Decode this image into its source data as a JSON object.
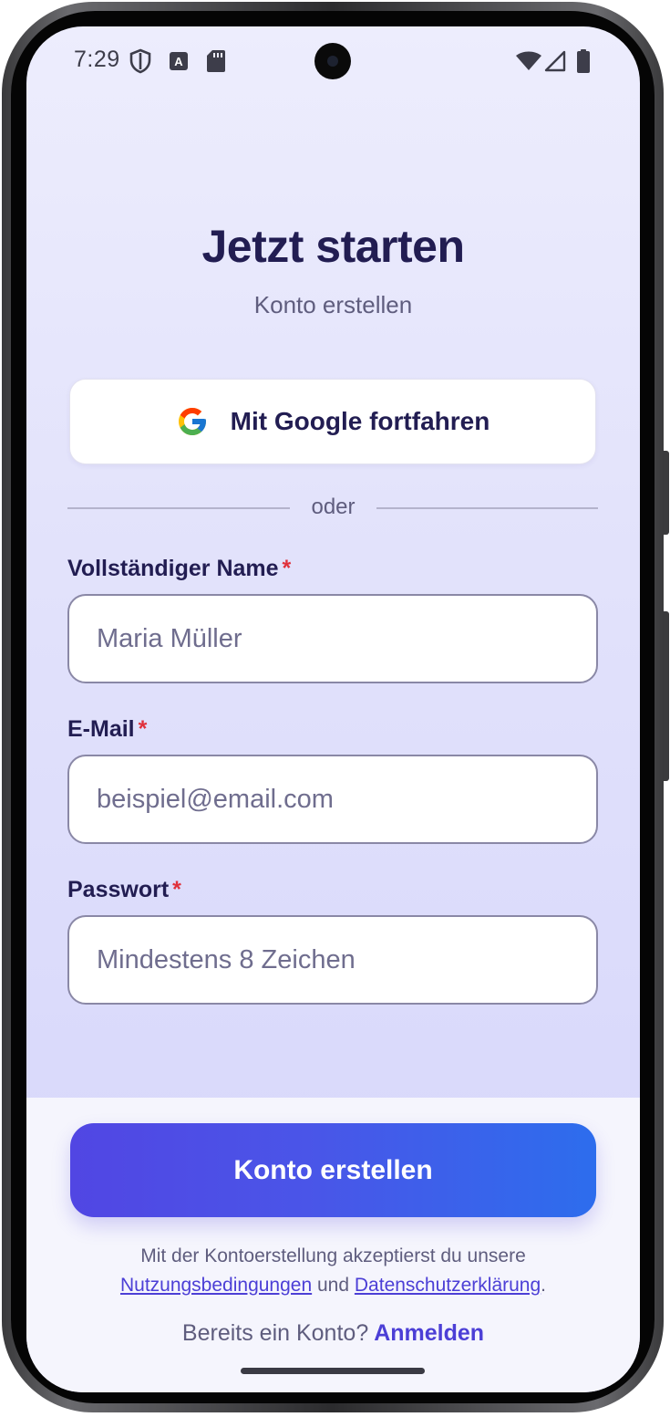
{
  "status_bar": {
    "time": "7:29",
    "left_icons": [
      "shield-icon",
      "font-a-icon",
      "sd-card-icon"
    ],
    "right_icons": [
      "wifi-icon",
      "cellular-signal-icon",
      "battery-icon"
    ]
  },
  "header": {
    "title": "Jetzt starten",
    "subtitle": "Konto erstellen"
  },
  "google_button": {
    "label": "Mit Google fortfahren",
    "icon": "google-logo-icon"
  },
  "divider": {
    "text": "oder"
  },
  "form": {
    "name": {
      "label": "Vollständiger Name",
      "required_mark": "*",
      "placeholder": "Maria Müller",
      "value": ""
    },
    "email": {
      "label": "E-Mail",
      "required_mark": "*",
      "placeholder": "beispiel@email.com",
      "value": ""
    },
    "password": {
      "label": "Passwort",
      "required_mark": "*",
      "placeholder": "Mindestens 8 Zeichen",
      "value": ""
    }
  },
  "submit_button": {
    "label": "Konto erstellen"
  },
  "legal": {
    "prefix": "Mit der Kontoerstellung akzeptierst du unsere",
    "terms_link": "Nutzungsbedingungen",
    "conjunction": "und",
    "privacy_link": "Datenschutzerklärung",
    "suffix": "."
  },
  "login": {
    "prompt": "Bereits ein Konto?",
    "link": "Anmelden"
  },
  "colors": {
    "accent": "#4c3fd6",
    "title": "#221d52",
    "required": "#e0313b",
    "button_gradient_start": "#5146e3",
    "button_gradient_end": "#2d6ded"
  }
}
